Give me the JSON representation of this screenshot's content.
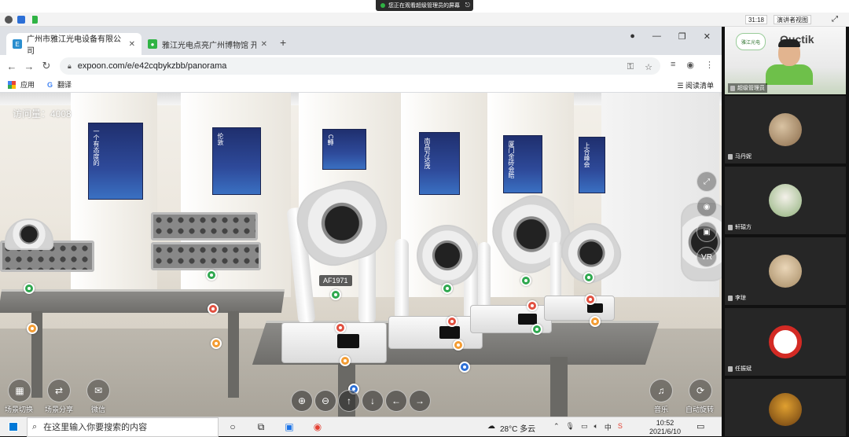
{
  "share_banner": {
    "text": "您正在观看超级管理员的屏幕"
  },
  "meeting_bar": {
    "timer": "31:18",
    "view_label": "演讲者视图"
  },
  "browser": {
    "tabs": [
      {
        "label": "广州市雅江光电设备有限公司",
        "active": true
      },
      {
        "label": "雅江光电点亮广州博物馆 开启时...",
        "active": false
      }
    ],
    "url": "expoon.com/e/e42cqbykzbb/panorama",
    "bookmarks": [
      {
        "label": "应用"
      },
      {
        "label": "翻译"
      }
    ],
    "reading_list": "阅读清单"
  },
  "panorama": {
    "visits": "访问量：4008",
    "product_label": "AF1971",
    "bottom_left_buttons": [
      {
        "label": "场景切换",
        "icon": "grid-icon"
      },
      {
        "label": "场景分享",
        "icon": "share-icon"
      },
      {
        "label": "微信",
        "icon": "wechat-icon"
      }
    ],
    "bottom_right_buttons": [
      {
        "label": "音乐",
        "icon": "music-icon"
      },
      {
        "label": "自动旋转",
        "icon": "rotate-icon"
      }
    ],
    "side_tools": [
      {
        "label": "",
        "icon": "fullscreen-icon"
      },
      {
        "label": "",
        "icon": "eye-icon"
      },
      {
        "label": "",
        "icon": "contact-icon"
      },
      {
        "label": "VR",
        "icon": "vr-icon"
      }
    ],
    "posters": [
      {
        "text": "一个有态度的"
      },
      {
        "text": "伦敦"
      },
      {
        "text": "C轉"
      },
      {
        "text": "南昌万达茂"
      },
      {
        "text": "厦门金砖会晤"
      },
      {
        "text": "上合峰会"
      }
    ]
  },
  "taskbar": {
    "search_placeholder": "在这里输入你要搜索的内容",
    "weather": "28°C 多云",
    "ime": "中",
    "time": "10:52",
    "date": "2021/6/10"
  },
  "participants": [
    {
      "name": "超级管理员",
      "is_host": true
    },
    {
      "name": "马丹妮"
    },
    {
      "name": "轩辕方"
    },
    {
      "name": "李琼"
    },
    {
      "name": "任振斌"
    },
    {
      "name": ""
    }
  ],
  "brand": {
    "logo_text": "雅江光电",
    "mark": "Ouctik"
  }
}
